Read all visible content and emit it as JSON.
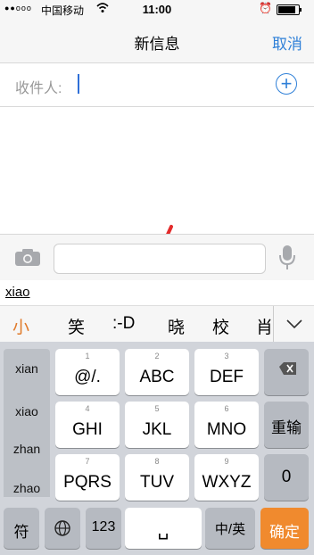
{
  "status_bar": {
    "signal": "●●ooo",
    "carrier": "中国移动",
    "time": "11:00",
    "battery_level": 0.85
  },
  "nav": {
    "title": "新信息",
    "cancel_label": "取消"
  },
  "recipient": {
    "label": "收件人:"
  },
  "composer": {
    "message_value": ""
  },
  "ime": {
    "pinyin_input": "xiao",
    "candidates": [
      "小",
      "笑",
      ":-D",
      "晓",
      "校",
      "肖"
    ],
    "pinyin_options": [
      "xian",
      "xiao",
      "zhan",
      "zhao"
    ],
    "keys_row1": [
      {
        "num": "1",
        "label": "@/."
      },
      {
        "num": "2",
        "label": "ABC"
      },
      {
        "num": "3",
        "label": "DEF"
      }
    ],
    "keys_row2": [
      {
        "num": "4",
        "label": "GHI"
      },
      {
        "num": "5",
        "label": "JKL"
      },
      {
        "num": "6",
        "label": "MNO"
      }
    ],
    "keys_row3": [
      {
        "num": "7",
        "label": "PQRS"
      },
      {
        "num": "8",
        "label": "TUV"
      },
      {
        "num": "9",
        "label": "WXYZ"
      }
    ],
    "reenter_label": "重输",
    "zero_label": "0",
    "symbol_label": "符",
    "num_label": "123",
    "space_label": "␣",
    "lang_label": "中/英",
    "confirm_label": "确定"
  },
  "colors": {
    "accent": "#2f80d8",
    "confirm": "#f08a2e",
    "arrow": "#e32b2b"
  }
}
